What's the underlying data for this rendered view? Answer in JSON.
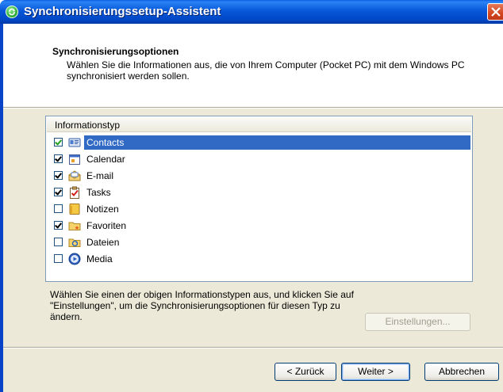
{
  "window": {
    "title": "Synchronisierungssetup-Assistent"
  },
  "header": {
    "title": "Synchronisierungsoptionen",
    "description": "Wählen Sie die Informationen aus, die von Ihrem Computer (Pocket PC) mit dem Windows PC synchronisiert werden sollen."
  },
  "list": {
    "column_header": "Informationstyp",
    "items": [
      {
        "label": "Contacts",
        "checked": true,
        "selected": true,
        "icon": "contacts-card-icon"
      },
      {
        "label": "Calendar",
        "checked": true,
        "selected": false,
        "icon": "calendar-icon"
      },
      {
        "label": "E-mail",
        "checked": true,
        "selected": false,
        "icon": "email-envelope-icon"
      },
      {
        "label": "Tasks",
        "checked": true,
        "selected": false,
        "icon": "tasks-clipboard-icon"
      },
      {
        "label": "Notizen",
        "checked": false,
        "selected": false,
        "icon": "notes-icon"
      },
      {
        "label": "Favoriten",
        "checked": true,
        "selected": false,
        "icon": "favorites-folder-icon"
      },
      {
        "label": "Dateien",
        "checked": false,
        "selected": false,
        "icon": "files-sync-icon"
      },
      {
        "label": "Media",
        "checked": false,
        "selected": false,
        "icon": "media-player-icon"
      }
    ]
  },
  "instructions": "Wählen Sie einen der obigen Informationstypen aus, und klicken Sie auf \"Einstellungen\", um die Synchronisierungsoptionen für diesen Typ zu ändern.",
  "buttons": {
    "settings": "Einstellungen...",
    "back": "< Zurück",
    "next": "Weiter >",
    "cancel": "Abbrechen"
  },
  "colors": {
    "titlebar": "#0054e3",
    "selection": "#316ac5",
    "dialog_bg": "#ece9d8"
  }
}
